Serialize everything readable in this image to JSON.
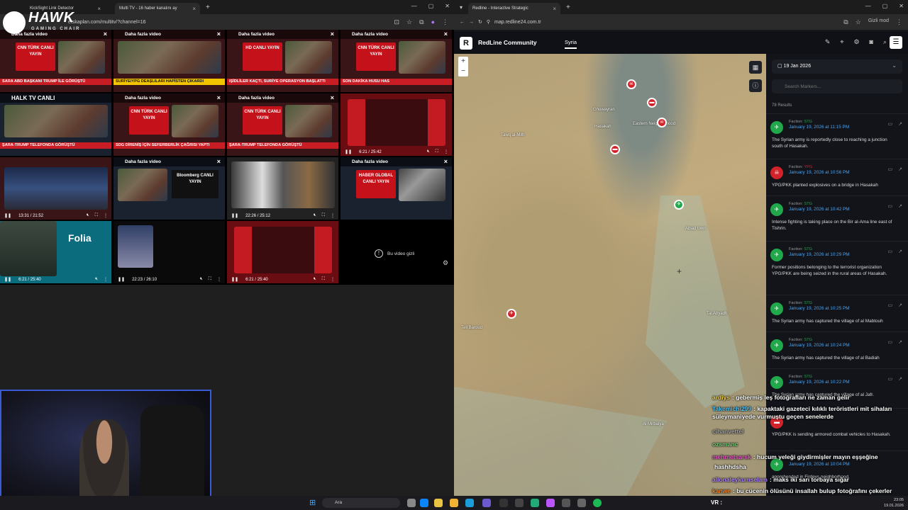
{
  "left_browser": {
    "tabs": [
      {
        "label": "KickSight Link Detector"
      },
      {
        "label": "Multi TV - 16 haber kanalını ay"
      }
    ],
    "url": "etskaplan.com/multitv/?channel=16",
    "cells": [
      {
        "header": "Daha fazla video",
        "logo": "CNN TÜRK CANLI YAYIN",
        "ticker": "SARA ABD BAŞKANI TRUMP İLE GÖRÜŞTÜ"
      },
      {
        "header": "Daha fazla video",
        "logo": "",
        "ticker": "SURİYE/YPG DEAŞLILARI HAPİSTEN ÇIKARDI"
      },
      {
        "header": "Daha fazla video",
        "logo": "HD CANLI YAYIN",
        "ticker": "IŞİDLİLER KAÇTI, SURİYE OPERASYON BAŞLATTI"
      },
      {
        "header": "Daha fazla video",
        "logo": "CNN TÜRK CANLI YAYIN",
        "ticker": "SON DAKİKA HUSU HAS"
      },
      {
        "header": "HALK TV CANLI",
        "logo": "",
        "ticker": "ŞARA-TRUMP TELEFONDA GÖRÜŞTÜ"
      },
      {
        "header": "Daha fazla video",
        "logo": "CNN TÜRK CANLI YAYIN",
        "ticker": "SDG DİRENİŞ İÇİN SEFERBERLİK ÇAĞRISI YAPTI"
      },
      {
        "header": "Daha fazla video",
        "logo": "CNN TÜRK CANLI YAYIN",
        "ticker": "ŞARA-TRUMP TELEFONDA GÖRÜŞTÜ"
      },
      {
        "header": "",
        "logo": "",
        "ticker": "",
        "time": "6:21 / 25:42"
      },
      {
        "header": "",
        "logo": "",
        "ticker": "",
        "time": "13:31 / 21:52"
      },
      {
        "header": "Daha fazla video",
        "logo": "Bloomberg CANLI YAYIN",
        "ticker": ""
      },
      {
        "header": "",
        "logo": "",
        "ticker": "",
        "time": "22:26 / 25:12"
      },
      {
        "header": "Daha fazla video",
        "logo": "HABER GLOBAL CANLI YAYIN",
        "ticker": ""
      },
      {
        "header": "",
        "logo": "",
        "ticker": "",
        "time": "6:21 / 25:40",
        "title": "Folia"
      },
      {
        "header": "",
        "logo": "",
        "ticker": "",
        "time": "22:23 / 26:10"
      },
      {
        "header": "",
        "logo": "",
        "ticker": "",
        "time": "6:21 / 25:40"
      }
    ],
    "hidden_video": "Bu video gizli"
  },
  "hawk_logo": {
    "title": "HAWK",
    "subtitle": "GAMING CHAIR"
  },
  "right_browser": {
    "tabs": [
      {
        "label": "Redline - Interactive Strategic"
      }
    ],
    "url": "map.redline24.com.tr",
    "incognito": "Gizli mod",
    "header": {
      "logo": "R",
      "title": "RedLine Community",
      "region": "Syria"
    },
    "date": "19 Jan 2026",
    "search_placeholder": "Search Markers...",
    "result_count": "78 Results",
    "events": [
      {
        "faction_label": "Faction:",
        "faction": "STG",
        "color": "green",
        "time": "January 19, 2026 at 11:15 PM",
        "text": "The Syrian army is reportedly close to reaching a junction south of Hasakah."
      },
      {
        "faction_label": "Faction:",
        "faction": "YPG",
        "color": "red",
        "time": "January 19, 2026 at 10:56 PM",
        "text": "YPG/PKK planted explosives on a bridge in Hasakah"
      },
      {
        "faction_label": "Faction:",
        "faction": "STG",
        "color": "green",
        "time": "January 19, 2026 at 10:42 PM",
        "text": "Intense fighting is taking place on the Bir al-Ama line east of Tishrin."
      },
      {
        "faction_label": "Faction:",
        "faction": "STG",
        "color": "green",
        "time": "January 19, 2026 at 10:29 PM",
        "text": "Former positions belonging to the terrorist organization YPG/PKK are being seized in the rural areas of Hasakah."
      },
      {
        "faction_label": "Faction:",
        "faction": "STG",
        "color": "green",
        "time": "January 19, 2026 at 10:25 PM",
        "text": "The Syrian army has captured the village of al Mabtouh"
      },
      {
        "faction_label": "Faction:",
        "faction": "STG",
        "color": "green",
        "time": "January 19, 2026 at 10:24 PM",
        "text": "The Syrian army has captured the village of al Badiah"
      },
      {
        "faction_label": "Faction:",
        "faction": "STG",
        "color": "green",
        "time": "January 19, 2026 at 10:22 PM",
        "text": "The Syrian army has captured the village of al Jafr."
      },
      {
        "faction_label": "",
        "faction": "",
        "color": "red",
        "time": "",
        "text": "YPG/PKK is sending armored combat vehicles to Hasakah."
      },
      {
        "faction_label": "",
        "faction": "",
        "color": "green",
        "time": "January 19, 2026 at 10:04 PM",
        "text": "apprehended in Firdevs neighborhood."
      }
    ],
    "places": [
      "Tawq al-Milh",
      "Hasakah",
      "Ghuwayran",
      "Eastern Neighborhood",
      "Abiad town",
      "Tell Baroud",
      "Tal Abyadh",
      "Al Mirbaiya"
    ]
  },
  "chat": [
    {
      "user": "ardiys",
      "user_color": "#f4d03f",
      "msg": ": gebermiş leş fotoğrafları ne zaman gelir"
    },
    {
      "user": "Takemichi299",
      "user_color": "#4fc3f7",
      "msg": ": kapaktaki gazeteci kılıklı teröristleri mit sihaları süleymaniyede vurmuştu geçen senelerde"
    },
    {
      "user": "cihanvettel",
      "user_color": "#aaaaaa",
      "msg": ""
    },
    {
      "user": "ozsmanc",
      "user_color": "#7bd17b",
      "msg": ""
    },
    {
      "user": "mehmetsarsk",
      "user_color": "#e65bc7",
      "msg": ": hucum yeleği giydirmişler mayın eşşeğine"
    },
    {
      "user": "",
      "user_color": "#ffffff",
      "msg": "hashhdsha"
    },
    {
      "user": "alionaleykumselam",
      "user_color": "#b084ff",
      "msg": ": maks iki sarı torbaya sığar"
    },
    {
      "user": "kanwe",
      "user_color": "#f28b30",
      "msg": ": bu cücenin ölüsünü insallah bulup fotoğrafını çekerler"
    }
  ],
  "taskbar": {
    "search": "Ara",
    "vr": "VR :",
    "time": "23:05",
    "date": "19.01.2026"
  }
}
